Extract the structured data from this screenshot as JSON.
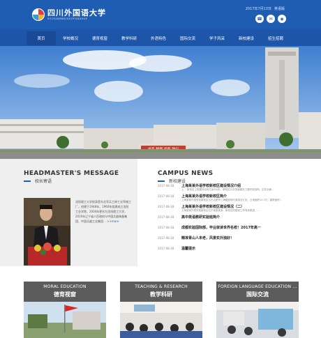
{
  "header": {
    "logo_cn": "四川外国语大学",
    "logo_en": "SICHUANWAIGUOYUDAXUE",
    "date": "2017年7月13日",
    "top_link": "英语版",
    "icons": [
      "phone-icon",
      "chat-icon",
      "weibo-icon"
    ]
  },
  "nav": {
    "items": [
      "首页",
      "学校概况",
      "德育视窗",
      "教学科研",
      "外语特色",
      "国际交流",
      "学子风采",
      "新校建设",
      "招生招聘"
    ]
  },
  "banner": {
    "sign_text": "求真 精细 尚新 致行"
  },
  "headmaster": {
    "title": "HEADMASTER'S MESSAGE",
    "subtitle": "校长寄语",
    "text": "沈阳理工大学前身是东北军兵工修工业军械工厂，创建于1948年，1960年组建成立沈阳工业学院，2004年更名为沈阳理工大学，2010年辽宁省人民政府与中国兵器装备集团、中国兵器工业集团...",
    "more": ">>more"
  },
  "news": {
    "title": "CAMPUS NEWS",
    "subtitle": "新校建设",
    "items": [
      {
        "date": "2017-08-18",
        "title": "上海某某外语学校新校区建设情况介绍",
        "desc": "上... 新校区工程建设目前已到5月份，新校区已在快速建设工程完成结构，正在全面..."
      },
      {
        "date": "2017-08-18",
        "title": "上海某某外语学校新校区简介",
        "desc": "上海某某外语学校新校区位于合肥市上海路西侧与某街交汇处，占地面积14.5万，建筑面积..."
      },
      {
        "date": "2017-08-18",
        "title": "上海某某外语学校新校区建设情况（二）",
        "desc": "上海某某外语学校新校区位于某某某某，新校区的建设工作有序推进，..."
      },
      {
        "date": "2017-08-18",
        "title": "高中英语教研实验班简介",
        "desc": ""
      },
      {
        "date": "2017-08-18",
        "title": "成都实验国际部，毕业就读世界名校！2017年高一",
        "desc": ""
      },
      {
        "date": "2017-08-18",
        "title": "精准青山人未老，风景实外独好！",
        "desc": ""
      },
      {
        "date": "2017-08-18",
        "title": "温馨提示",
        "desc": ""
      }
    ]
  },
  "cards": [
    {
      "en": "MORAL EDUCATION",
      "cn": "德育视窗"
    },
    {
      "en": "TEACHING & RESEARCH",
      "cn": "教学科研"
    },
    {
      "en": "FOREIGN LANGUAGE EDUCATION ...",
      "cn": "国际交流"
    }
  ]
}
